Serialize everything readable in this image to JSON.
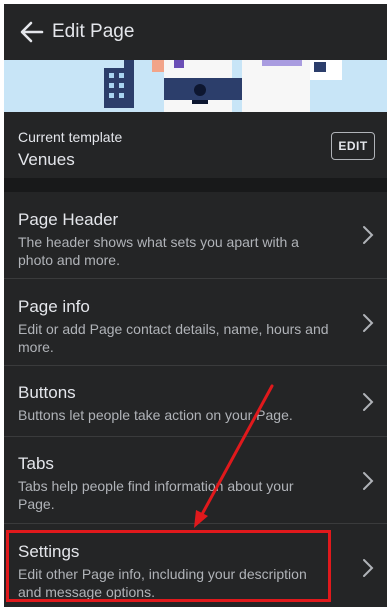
{
  "appbar": {
    "title": "Edit Page",
    "back_icon": "arrow-left-icon"
  },
  "template": {
    "label": "Current template",
    "value": "Venues",
    "edit_label": "EDIT"
  },
  "menu": [
    {
      "title": "Page Header",
      "desc": "The header shows what sets you apart with a photo and more."
    },
    {
      "title": "Page info",
      "desc": "Edit or add Page contact details, name, hours and more."
    },
    {
      "title": "Buttons",
      "desc": "Buttons let people take action on your Page."
    },
    {
      "title": "Tabs",
      "desc": "Tabs help people find information about your Page."
    },
    {
      "title": "Settings",
      "desc": "Edit other Page info, including your description and message options."
    }
  ],
  "annotation": {
    "highlight_color": "#e0191c",
    "icons": [
      "annotation-arrow",
      "highlight-box"
    ]
  },
  "colors": {
    "background": "#1f1f1f",
    "surface": "#242526",
    "text_primary": "#e4e6eb",
    "text_secondary": "#b0b3b8",
    "banner": "#c8e5f7",
    "annotation": "#e0191c"
  }
}
